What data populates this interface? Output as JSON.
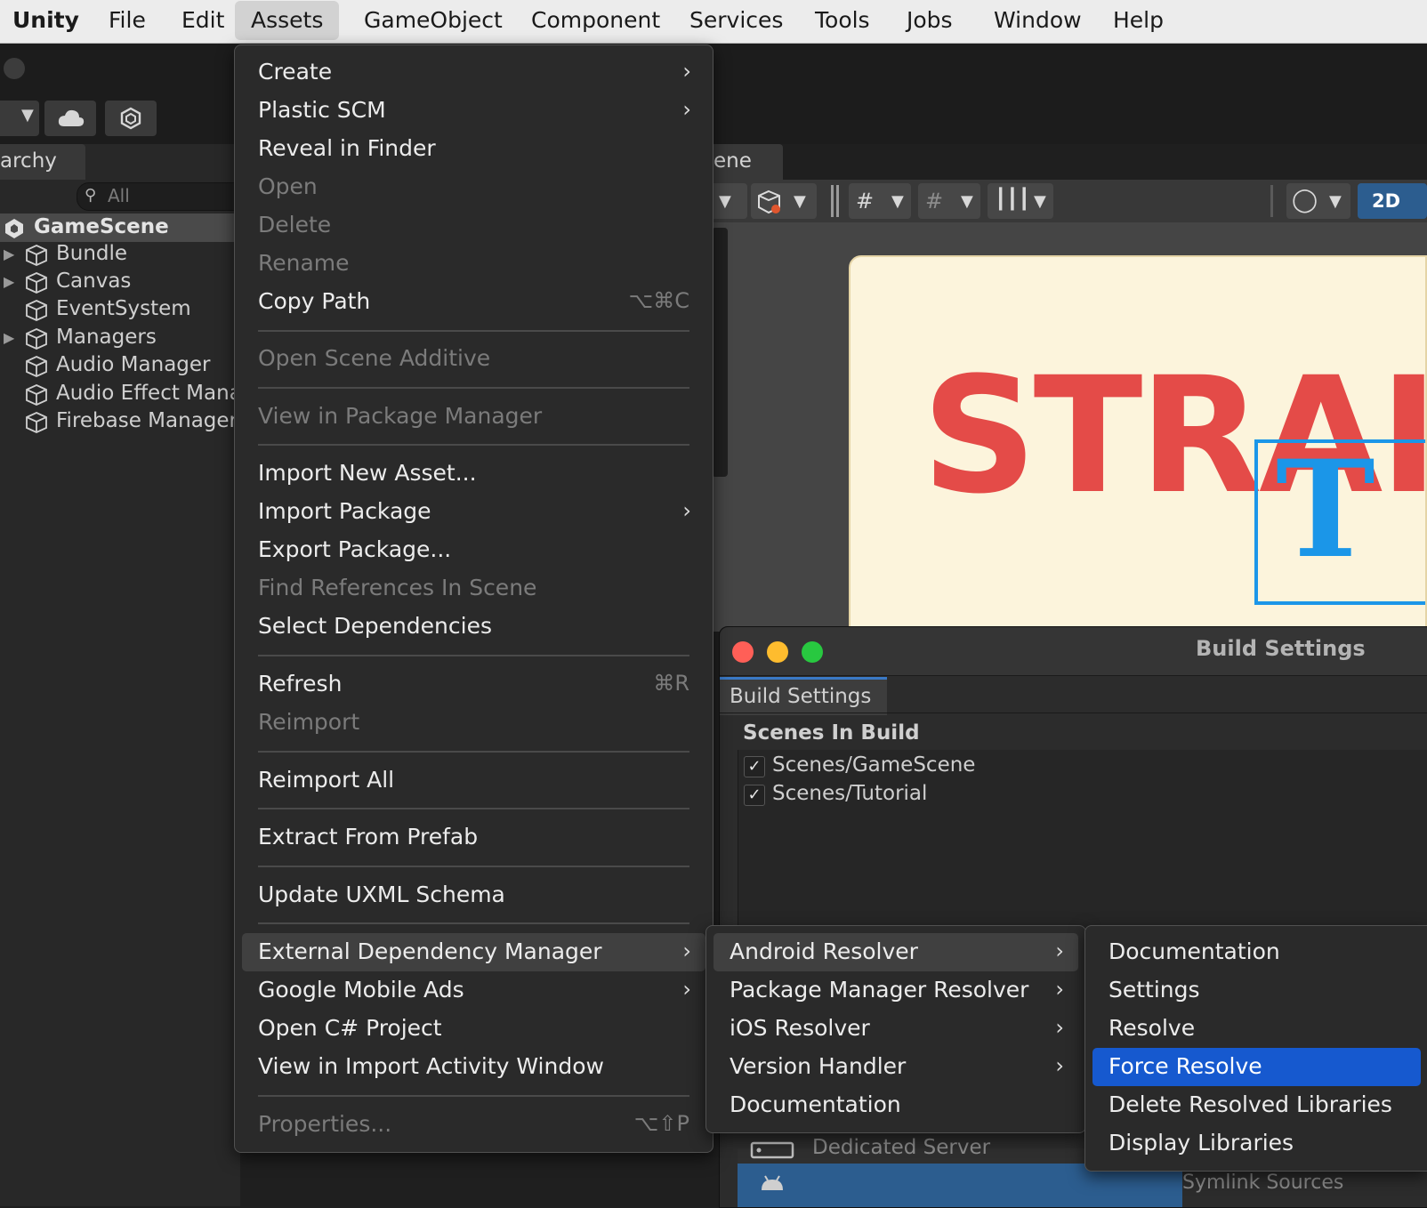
{
  "menubar": {
    "app": "Unity",
    "items": [
      "File",
      "Edit",
      "Assets",
      "GameObject",
      "Component",
      "Services",
      "Tools",
      "Jobs",
      "Window",
      "Help"
    ]
  },
  "hierarchy": {
    "tab_label": "archy",
    "search_placeholder": "All",
    "scene": "GameScene",
    "items": [
      "Bundle",
      "Canvas",
      "EventSystem",
      "Managers",
      "Audio Manager",
      "Audio Effect Mana",
      "Firebase Manager"
    ]
  },
  "scene_view": {
    "tab_label": "ene",
    "mode_2d": "2D",
    "game_title": "STRAI",
    "gizmo_letter": "T"
  },
  "build_settings": {
    "title": "Build Settings",
    "tab": "Build Settings",
    "scenes_label": "Scenes In Build",
    "scenes": [
      "Scenes/GameScene",
      "Scenes/Tutorial"
    ],
    "platform_ghost": "Dedicated Server",
    "symlink": "Symlink Sources"
  },
  "assets_menu": {
    "create": "Create",
    "plastic": "Plastic SCM",
    "reveal": "Reveal in Finder",
    "open": "Open",
    "delete": "Delete",
    "rename": "Rename",
    "copy_path": "Copy Path",
    "copy_path_shortcut": "⌥⌘C",
    "open_additive": "Open Scene Additive",
    "view_pkg": "View in Package Manager",
    "import_new": "Import New Asset...",
    "import_pkg": "Import Package",
    "export_pkg": "Export Package...",
    "find_refs": "Find References In Scene",
    "select_deps": "Select Dependencies",
    "refresh": "Refresh",
    "refresh_shortcut": "⌘R",
    "reimport": "Reimport",
    "reimport_all": "Reimport All",
    "extract_prefab": "Extract From Prefab",
    "update_uxml": "Update UXML Schema",
    "ext_dep": "External Dependency Manager",
    "google_ads": "Google Mobile Ads",
    "open_cs": "Open C# Project",
    "view_import": "View in Import Activity Window",
    "properties": "Properties...",
    "properties_shortcut": "⌥⇧P"
  },
  "edm_menu": {
    "android": "Android Resolver",
    "pkg_manager": "Package Manager Resolver",
    "ios": "iOS Resolver",
    "version": "Version Handler",
    "docs": "Documentation"
  },
  "android_menu": {
    "documentation": "Documentation",
    "settings": "Settings",
    "resolve": "Resolve",
    "force_resolve": "Force Resolve",
    "delete_libs": "Delete Resolved Libraries",
    "display_libs": "Display Libraries"
  },
  "colors": {
    "selection": "#1659cf",
    "game_title": "#e44b48",
    "gizmo": "#1b96e8"
  }
}
